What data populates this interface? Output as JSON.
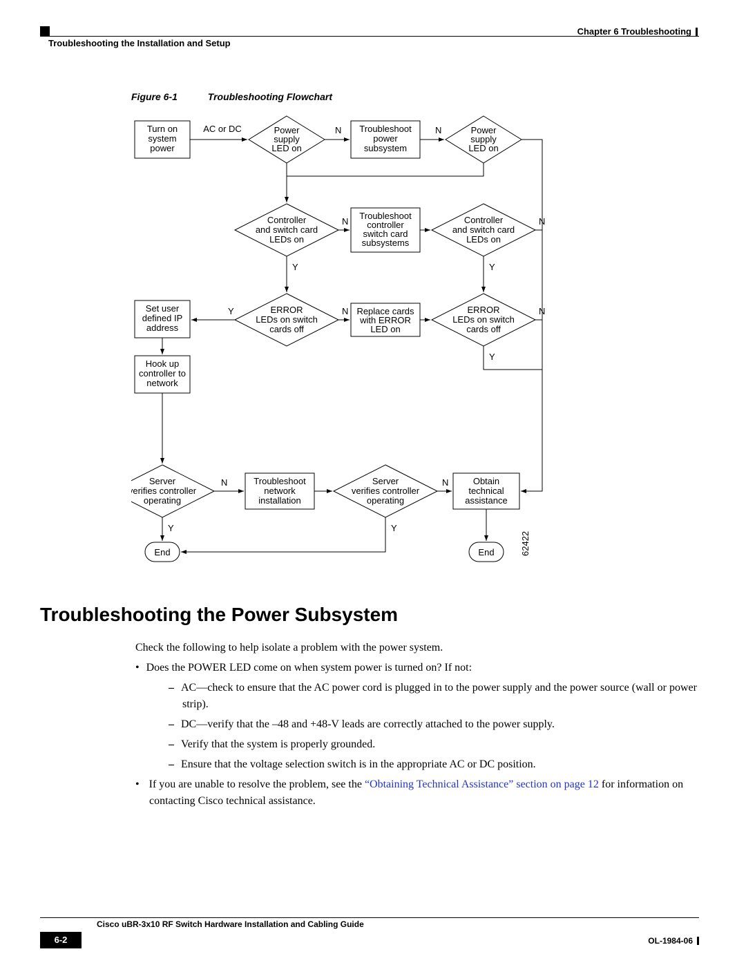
{
  "header": {
    "chapter": "Chapter 6    Troubleshooting",
    "section": "Troubleshooting the Installation and Setup"
  },
  "figure": {
    "number": "Figure 6-1",
    "title": "Troubleshooting Flowchart",
    "image_id": "62422",
    "nodes": {
      "turn_on": "Turn on\nsystem\npower",
      "ac_or_dc": "AC or DC",
      "ps_led_1": "Power\nsupply\nLED on",
      "ts_power": "Troubleshoot\npower\nsubsystem",
      "ps_led_2": "Power\nsupply\nLED on",
      "ctrl_led_1": "Controller\nand switch card\nLEDs on",
      "ts_ctrl": "Troubleshoot\ncontroller\nswitch card\nsubsystems",
      "ctrl_led_2": "Controller\nand switch card\nLEDs on",
      "set_ip": "Set user\ndefined IP\naddress",
      "err_led_1": "ERROR\nLEDs on switch\ncards off",
      "replace": "Replace cards\nwith ERROR\nLED on",
      "err_led_2": "ERROR\nLEDs on switch\ncards off",
      "hook_up": "Hook up\ncontroller to\nnetwork",
      "server_1": "Server\nverifies controller\noperating",
      "ts_net": "Troubleshoot\nnetwork\ninstallation",
      "server_2": "Server\nverifies controller\noperating",
      "obtain": "Obtain\ntechnical\nassistance",
      "end_l": "End",
      "end_r": "End"
    },
    "labels": {
      "y": "Y",
      "n": "N"
    }
  },
  "section_title": "Troubleshooting the Power Subsystem",
  "body": {
    "intro": "Check the following to help isolate a problem with the power system.",
    "b1": "Does the POWER LED come on when system power is turned on? If not:",
    "s1": "AC—check to ensure that the AC power cord is plugged in to the power supply and the power source (wall or power strip).",
    "s2": "DC—verify that the –48 and +48-V leads are correctly attached to the power supply.",
    "s3": "Verify that the system is properly grounded.",
    "s4": "Ensure that the voltage selection switch is in the appropriate AC or DC position.",
    "b2a": "If you are unable to resolve the problem, see the ",
    "b2link": "“Obtaining Technical Assistance” section on page 12",
    "b2b": " for information on contacting Cisco technical assistance."
  },
  "footer": {
    "title": "Cisco uBR-3x10 RF Switch Hardware Installation and Cabling Guide",
    "page": "6-2",
    "doc": "OL-1984-06"
  }
}
